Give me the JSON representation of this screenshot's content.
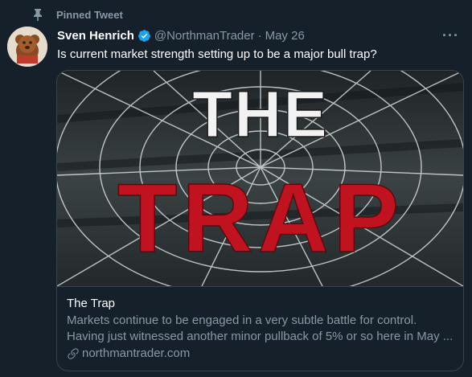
{
  "pinned": {
    "label": "Pinned Tweet",
    "icon": "pin-icon"
  },
  "tweet": {
    "author_name": "Sven Henrich",
    "verified": true,
    "handle": "@NorthmanTrader",
    "separator": "·",
    "date": "May 26",
    "more": "···",
    "text": "Is current market strength setting up to be a major bull trap?"
  },
  "card": {
    "image_line1": "THE",
    "image_line2": "TRAP",
    "title": "The Trap",
    "description_line1": "Markets continue to be engaged in a very subtle battle for control.",
    "description_line2": "Having just witnessed another minor pullback of 5% or so here in May ...",
    "domain": "northmantrader.com",
    "link_icon": "link-icon"
  },
  "colors": {
    "background": "#15202b",
    "secondary_text": "#8899a6",
    "border": "#38444d",
    "verified_blue": "#1da1f2",
    "trap_red": "#c1121f"
  }
}
